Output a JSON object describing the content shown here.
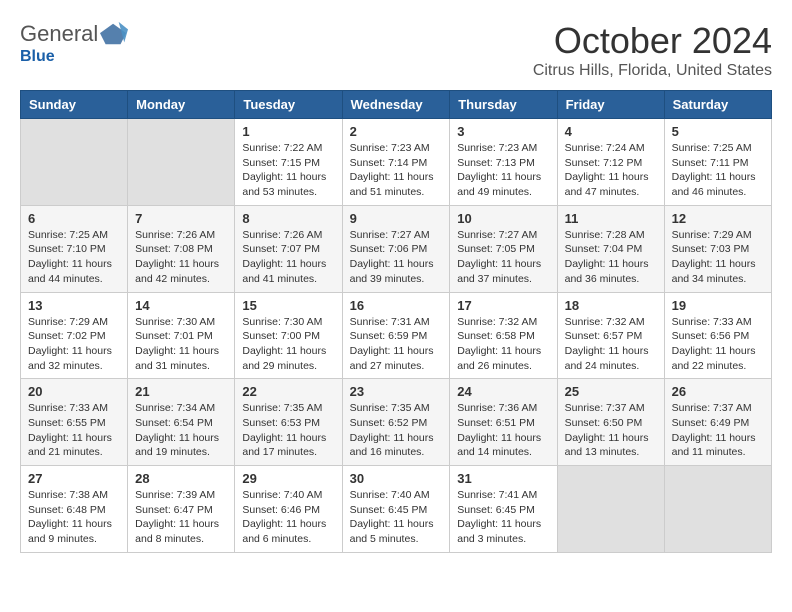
{
  "header": {
    "logo_general": "General",
    "logo_blue": "Blue",
    "title": "October 2024",
    "subtitle": "Citrus Hills, Florida, United States"
  },
  "columns": [
    "Sunday",
    "Monday",
    "Tuesday",
    "Wednesday",
    "Thursday",
    "Friday",
    "Saturday"
  ],
  "weeks": [
    {
      "row_class": "week-row-1",
      "days": [
        {
          "num": "",
          "info": ""
        },
        {
          "num": "",
          "info": ""
        },
        {
          "num": "1",
          "info": "Sunrise: 7:22 AM\nSunset: 7:15 PM\nDaylight: 11 hours\nand 53 minutes."
        },
        {
          "num": "2",
          "info": "Sunrise: 7:23 AM\nSunset: 7:14 PM\nDaylight: 11 hours\nand 51 minutes."
        },
        {
          "num": "3",
          "info": "Sunrise: 7:23 AM\nSunset: 7:13 PM\nDaylight: 11 hours\nand 49 minutes."
        },
        {
          "num": "4",
          "info": "Sunrise: 7:24 AM\nSunset: 7:12 PM\nDaylight: 11 hours\nand 47 minutes."
        },
        {
          "num": "5",
          "info": "Sunrise: 7:25 AM\nSunset: 7:11 PM\nDaylight: 11 hours\nand 46 minutes."
        }
      ]
    },
    {
      "row_class": "week-row-2",
      "days": [
        {
          "num": "6",
          "info": "Sunrise: 7:25 AM\nSunset: 7:10 PM\nDaylight: 11 hours\nand 44 minutes."
        },
        {
          "num": "7",
          "info": "Sunrise: 7:26 AM\nSunset: 7:08 PM\nDaylight: 11 hours\nand 42 minutes."
        },
        {
          "num": "8",
          "info": "Sunrise: 7:26 AM\nSunset: 7:07 PM\nDaylight: 11 hours\nand 41 minutes."
        },
        {
          "num": "9",
          "info": "Sunrise: 7:27 AM\nSunset: 7:06 PM\nDaylight: 11 hours\nand 39 minutes."
        },
        {
          "num": "10",
          "info": "Sunrise: 7:27 AM\nSunset: 7:05 PM\nDaylight: 11 hours\nand 37 minutes."
        },
        {
          "num": "11",
          "info": "Sunrise: 7:28 AM\nSunset: 7:04 PM\nDaylight: 11 hours\nand 36 minutes."
        },
        {
          "num": "12",
          "info": "Sunrise: 7:29 AM\nSunset: 7:03 PM\nDaylight: 11 hours\nand 34 minutes."
        }
      ]
    },
    {
      "row_class": "week-row-3",
      "days": [
        {
          "num": "13",
          "info": "Sunrise: 7:29 AM\nSunset: 7:02 PM\nDaylight: 11 hours\nand 32 minutes."
        },
        {
          "num": "14",
          "info": "Sunrise: 7:30 AM\nSunset: 7:01 PM\nDaylight: 11 hours\nand 31 minutes."
        },
        {
          "num": "15",
          "info": "Sunrise: 7:30 AM\nSunset: 7:00 PM\nDaylight: 11 hours\nand 29 minutes."
        },
        {
          "num": "16",
          "info": "Sunrise: 7:31 AM\nSunset: 6:59 PM\nDaylight: 11 hours\nand 27 minutes."
        },
        {
          "num": "17",
          "info": "Sunrise: 7:32 AM\nSunset: 6:58 PM\nDaylight: 11 hours\nand 26 minutes."
        },
        {
          "num": "18",
          "info": "Sunrise: 7:32 AM\nSunset: 6:57 PM\nDaylight: 11 hours\nand 24 minutes."
        },
        {
          "num": "19",
          "info": "Sunrise: 7:33 AM\nSunset: 6:56 PM\nDaylight: 11 hours\nand 22 minutes."
        }
      ]
    },
    {
      "row_class": "week-row-4",
      "days": [
        {
          "num": "20",
          "info": "Sunrise: 7:33 AM\nSunset: 6:55 PM\nDaylight: 11 hours\nand 21 minutes."
        },
        {
          "num": "21",
          "info": "Sunrise: 7:34 AM\nSunset: 6:54 PM\nDaylight: 11 hours\nand 19 minutes."
        },
        {
          "num": "22",
          "info": "Sunrise: 7:35 AM\nSunset: 6:53 PM\nDaylight: 11 hours\nand 17 minutes."
        },
        {
          "num": "23",
          "info": "Sunrise: 7:35 AM\nSunset: 6:52 PM\nDaylight: 11 hours\nand 16 minutes."
        },
        {
          "num": "24",
          "info": "Sunrise: 7:36 AM\nSunset: 6:51 PM\nDaylight: 11 hours\nand 14 minutes."
        },
        {
          "num": "25",
          "info": "Sunrise: 7:37 AM\nSunset: 6:50 PM\nDaylight: 11 hours\nand 13 minutes."
        },
        {
          "num": "26",
          "info": "Sunrise: 7:37 AM\nSunset: 6:49 PM\nDaylight: 11 hours\nand 11 minutes."
        }
      ]
    },
    {
      "row_class": "week-row-5",
      "days": [
        {
          "num": "27",
          "info": "Sunrise: 7:38 AM\nSunset: 6:48 PM\nDaylight: 11 hours\nand 9 minutes."
        },
        {
          "num": "28",
          "info": "Sunrise: 7:39 AM\nSunset: 6:47 PM\nDaylight: 11 hours\nand 8 minutes."
        },
        {
          "num": "29",
          "info": "Sunrise: 7:40 AM\nSunset: 6:46 PM\nDaylight: 11 hours\nand 6 minutes."
        },
        {
          "num": "30",
          "info": "Sunrise: 7:40 AM\nSunset: 6:45 PM\nDaylight: 11 hours\nand 5 minutes."
        },
        {
          "num": "31",
          "info": "Sunrise: 7:41 AM\nSunset: 6:45 PM\nDaylight: 11 hours\nand 3 minutes."
        },
        {
          "num": "",
          "info": ""
        },
        {
          "num": "",
          "info": ""
        }
      ]
    }
  ]
}
